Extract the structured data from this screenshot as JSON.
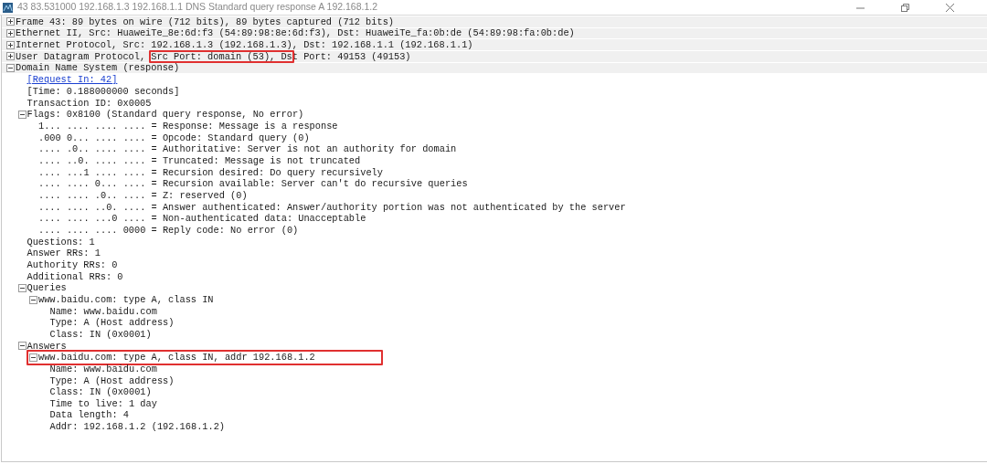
{
  "window": {
    "title": "43 83.531000 192.168.1.3 192.168.1.1 DNS Standard query response A 192.168.1.2"
  },
  "tree": [
    {
      "text": "Frame 43: 89 bytes on wire (712 bits), 89 bytes captured (712 bits)",
      "expanded": false
    },
    {
      "text": "Ethernet II, Src: HuaweiTe_8e:6d:f3 (54:89:98:8e:6d:f3), Dst: HuaweiTe_fa:0b:de (54:89:98:fa:0b:de)",
      "expanded": false
    },
    {
      "text": "Internet Protocol, Src: 192.168.1.3 (192.168.1.3), Dst: 192.168.1.1 (192.168.1.1)",
      "expanded": false
    },
    {
      "text": "User Datagram Protocol, Src Port: domain (53), Dst Port: 49153 (49153)",
      "expanded": false,
      "kind": "partboxed"
    },
    {
      "text": "Domain Name System (response)",
      "expanded": true,
      "children": [
        {
          "text": "[Request In: 42]",
          "kind": "link"
        },
        {
          "text": "[Time: 0.188000000 seconds]"
        },
        {
          "text": "Transaction ID: 0x0005"
        },
        {
          "text": "Flags: 0x8100 (Standard query response, No error)",
          "expanded": true,
          "children": [
            {
              "text": "1... .... .... .... = Response: Message is a response"
            },
            {
              "text": ".000 0... .... .... = Opcode: Standard query (0)"
            },
            {
              "text": ".... .0.. .... .... = Authoritative: Server is not an authority for domain"
            },
            {
              "text": ".... ..0. .... .... = Truncated: Message is not truncated"
            },
            {
              "text": ".... ...1 .... .... = Recursion desired: Do query recursively"
            },
            {
              "text": ".... .... 0... .... = Recursion available: Server can't do recursive queries"
            },
            {
              "text": ".... .... .0.. .... = Z: reserved (0)"
            },
            {
              "text": ".... .... ..0. .... = Answer authenticated: Answer/authority portion was not authenticated by the server"
            },
            {
              "text": ".... .... ...0 .... = Non-authenticated data: Unacceptable"
            },
            {
              "text": ".... .... .... 0000 = Reply code: No error (0)"
            }
          ]
        },
        {
          "text": "Questions: 1"
        },
        {
          "text": "Answer RRs: 1"
        },
        {
          "text": "Authority RRs: 0"
        },
        {
          "text": "Additional RRs: 0"
        },
        {
          "text": "Queries",
          "expanded": true,
          "children": [
            {
              "text": "www.baidu.com: type A, class IN",
              "expanded": true,
              "children": [
                {
                  "text": "Name: www.baidu.com"
                },
                {
                  "text": "Type: A (Host address)"
                },
                {
                  "text": "Class: IN (0x0001)"
                }
              ]
            }
          ]
        },
        {
          "text": "Answers",
          "expanded": true,
          "children": [
            {
              "text": "www.baidu.com: type A, class IN, addr 192.168.1.2",
              "expanded": true,
              "kind": "boxed",
              "children": [
                {
                  "text": "Name: www.baidu.com"
                },
                {
                  "text": "Type: A (Host address)"
                },
                {
                  "text": "Class: IN (0x0001)"
                },
                {
                  "text": "Time to live: 1 day"
                },
                {
                  "text": "Data length: 4"
                },
                {
                  "text": "Addr: 192.168.1.2 (192.168.1.2)"
                }
              ]
            }
          ]
        }
      ]
    }
  ]
}
